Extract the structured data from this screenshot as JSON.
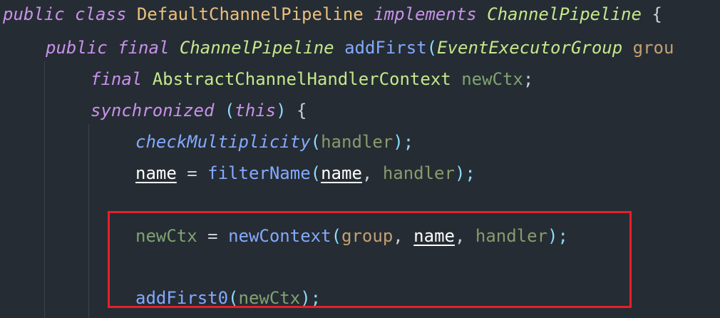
{
  "code": {
    "line1": {
      "kw_public": "public",
      "kw_class": "class",
      "class_name": "DefaultChannelPipeline",
      "kw_implements": "implements",
      "iface": "ChannelPipeline",
      "brace": "{"
    },
    "line2": {
      "kw_public": "public",
      "kw_final": "final",
      "ret_type": "ChannelPipeline",
      "method": "addFirst",
      "paren": "(",
      "param_type": "EventExecutorGroup",
      "param_name": "grou"
    },
    "line3": {
      "kw_final": "final",
      "type": "AbstractChannelHandlerContext",
      "var": "newCtx",
      "semi": ";"
    },
    "line4": {
      "kw_sync": "synchronized",
      "open": "(",
      "kw_this": "this",
      "close": ")",
      "brace": "{"
    },
    "line5": {
      "method": "checkMultiplicity",
      "open": "(",
      "arg": "handler",
      "close": ");"
    },
    "line6": {
      "field": "name",
      "eq": " = ",
      "method": "filterName",
      "open": "(",
      "arg1": "name",
      "comma": ", ",
      "arg2": "handler",
      "close": ");"
    },
    "line7": {
      "var": "newCtx",
      "eq": " = ",
      "method": "newContext",
      "open": "(",
      "arg1": "group",
      "comma1": ", ",
      "arg2": "name",
      "comma2": ", ",
      "arg3": "handler",
      "close": ");"
    },
    "line8": {
      "method": "addFirst0",
      "open": "(",
      "arg": "newCtx",
      "close": ");"
    }
  },
  "colors": {
    "background": "#262c33",
    "highlight_border": "#e5202a"
  }
}
